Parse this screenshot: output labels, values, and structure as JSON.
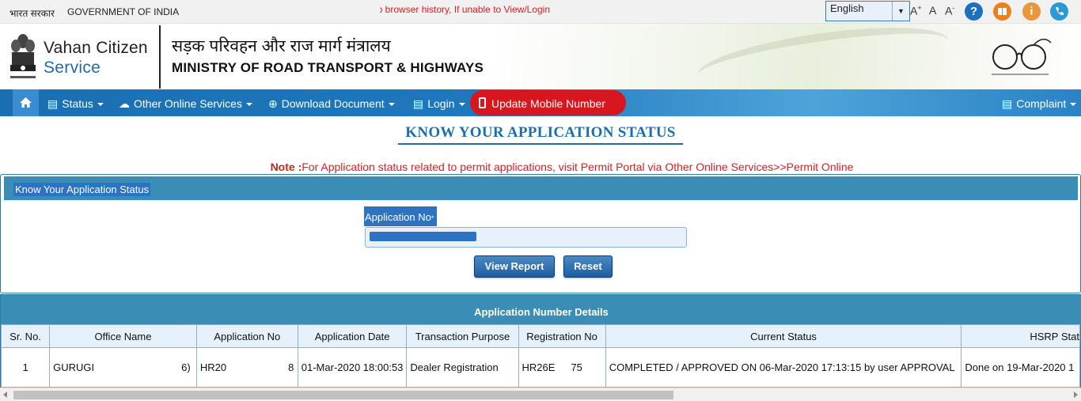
{
  "topbar": {
    "gov_hindi": "भारत सरकार",
    "gov_english": "GOVERNMENT OF INDIA",
    "marquee": "eb browser history, If unable to View/Login",
    "language_selected": "English",
    "font_increase": "A",
    "font_normal": "A",
    "font_decrease": "A",
    "font_increase_mark": "+",
    "font_decrease_mark": "-"
  },
  "header": {
    "brand_line1": "Vahan Citizen",
    "brand_line2": "Service",
    "ministry_hindi": "सड़क परिवहन और राज मार्ग मंत्रालय",
    "ministry_english": "MINISTRY OF ROAD TRANSPORT & HIGHWAYS"
  },
  "nav": {
    "status": "Status",
    "other_services": "Other Online Services",
    "download": "Download Document",
    "login": "Login",
    "update_mobile": "Update Mobile Number",
    "complaint": "Complaint"
  },
  "main": {
    "title": "KNOW YOUR APPLICATION STATUS",
    "note_label": "Note :",
    "note_text": "For Application status related to permit applications, visit Permit Portal via Other Online Services>>Permit Online",
    "panel_title": "Know Your Application Status",
    "app_no_label": "Application No",
    "app_no_required": "*",
    "app_no_value": "",
    "view_report": "View Report",
    "reset": "Reset"
  },
  "details": {
    "title": "Application Number Details",
    "columns": [
      "Sr. No.",
      "Office Name",
      "Application No",
      "Application Date",
      "Transaction Purpose",
      "Registration No",
      "Current Status",
      "HSRP Stat"
    ],
    "rows": [
      {
        "sr": "1",
        "office": "GURUGI",
        "office_tail": "6)",
        "app_no": "HR20",
        "app_no_tail": "8",
        "date": "01-Mar-2020 18:00:53",
        "purpose": "Dealer Registration",
        "reg_no": "HR26E",
        "reg_no_tail": "75",
        "status": "COMPLETED / APPROVED ON 06-Mar-2020 17:13:15 by user APPROVAL",
        "hsrp": "Done on 19-Mar-2020 1"
      }
    ]
  },
  "colors": {
    "nav_blue": "#1e78bd",
    "panel_blue": "#3a8db5",
    "title_blue": "#1f6ea8",
    "alert_red": "#e31b23"
  }
}
